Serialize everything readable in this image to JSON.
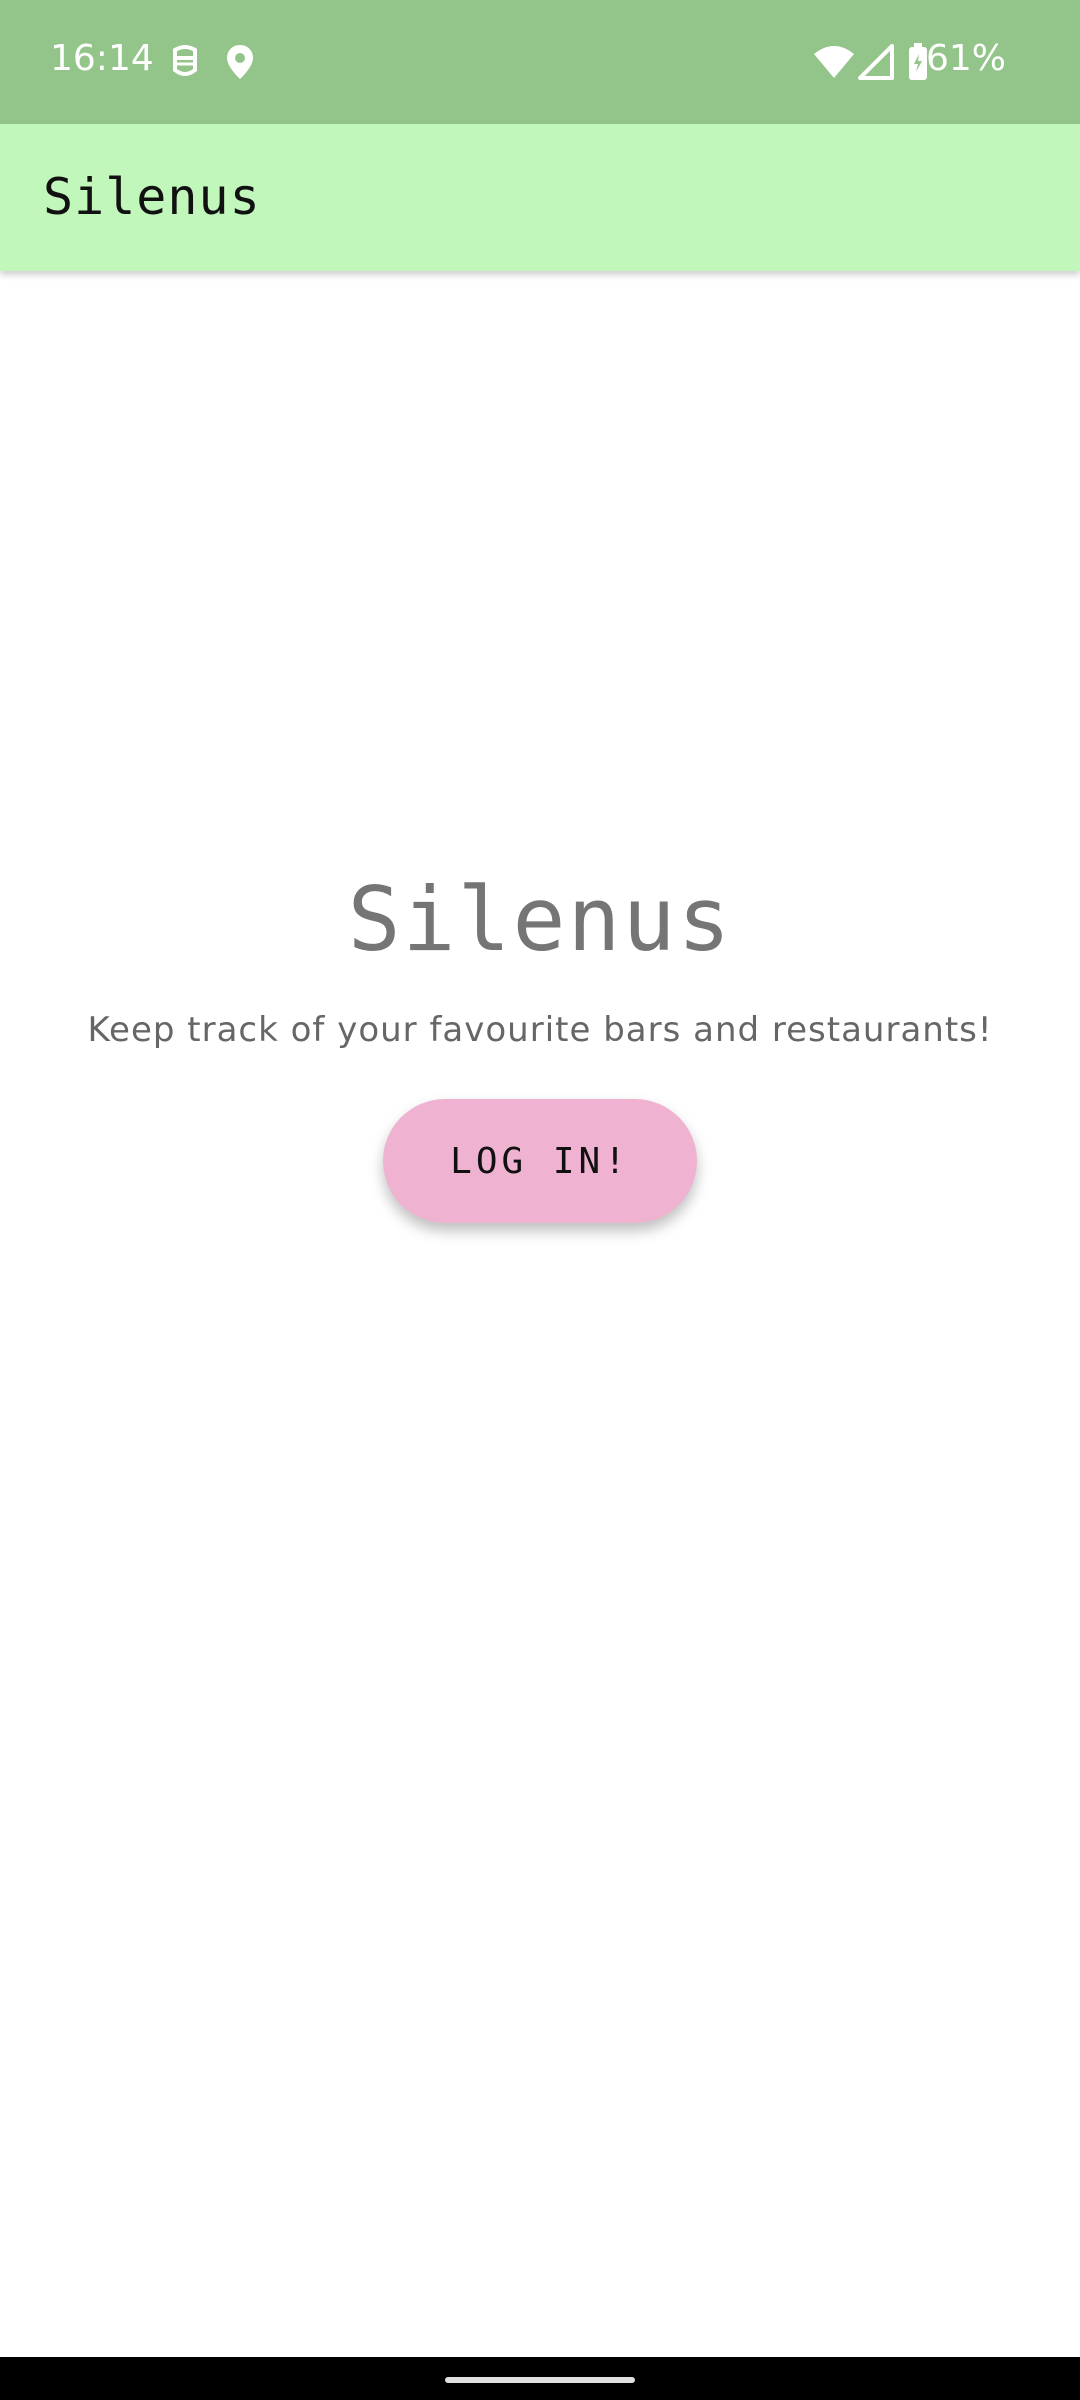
{
  "status_bar": {
    "time": "16:14",
    "battery_percent": "61%",
    "icons": [
      "notification-icon",
      "location-icon",
      "wifi-icon",
      "cell-signal-icon",
      "battery-icon"
    ],
    "background_color": "#93c58a"
  },
  "app_bar": {
    "title": "Silenus",
    "background_color": "#c1f7ba"
  },
  "main": {
    "title": "Silenus",
    "subtitle": "Keep track of your favourite bars and restaurants!",
    "login_button_label": "LOG IN!",
    "login_button_color": "#efb3d1"
  }
}
